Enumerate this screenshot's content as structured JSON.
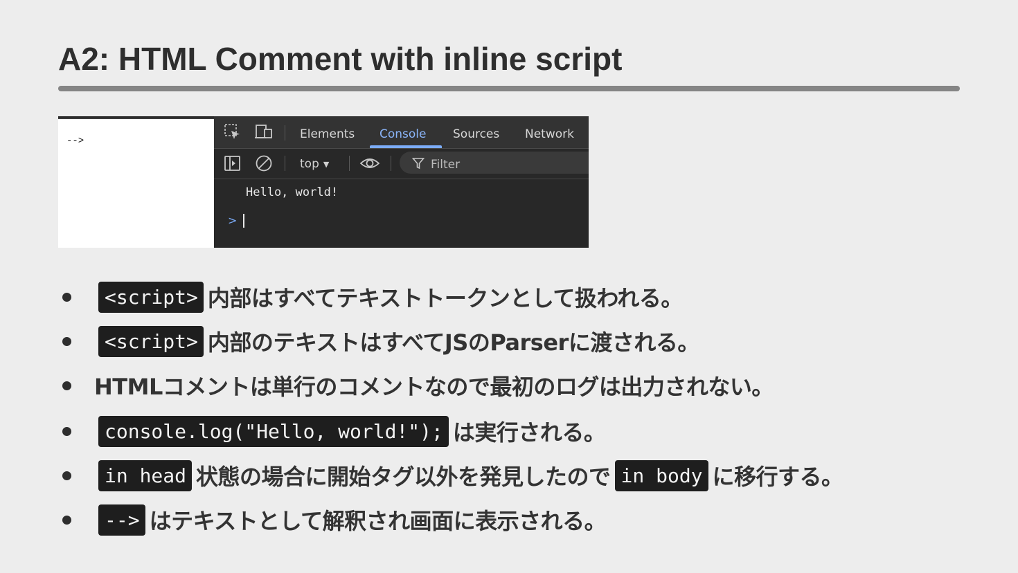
{
  "slide": {
    "title": "A2: HTML Comment with inline script"
  },
  "screenshot": {
    "page_text": "-->",
    "devtools": {
      "tabs": [
        {
          "label": "Elements",
          "active": false
        },
        {
          "label": "Console",
          "active": true
        },
        {
          "label": "Sources",
          "active": false
        },
        {
          "label": "Network",
          "active": false
        }
      ],
      "toolbar": {
        "context": "top",
        "filter_placeholder": "Filter"
      },
      "console_output": "Hello, world!",
      "prompt_symbol": ">"
    },
    "icons": [
      "inspect-element-icon",
      "device-toolbar-icon",
      "sidebar-toggle-icon",
      "clear-console-icon",
      "live-expression-eye-icon",
      "filter-funnel-icon"
    ]
  },
  "bullets": [
    {
      "code": "<script>",
      "text": "内部はすべてテキストトークンとして扱われる。"
    },
    {
      "code": "<script>",
      "text": "内部のテキストはすべてJSのParserに渡される。"
    },
    {
      "text": "HTMLコメントは単行のコメントなので最初のログは出力されない。"
    },
    {
      "code": "console.log(\"Hello, world!\");",
      "text": "は実行される。"
    },
    {
      "code": "in head",
      "text": "状態の場合に開始タグ以外を発見したので",
      "code2": "in body",
      "text2": "に移行する。"
    },
    {
      "code": "-->",
      "text": "はテキストとして解釈され画面に表示される。"
    }
  ],
  "colors": {
    "background": "#ededed",
    "code_bg": "#1e1e1e",
    "devtools_bg": "#282828",
    "active_tab": "#8ab4f8"
  }
}
